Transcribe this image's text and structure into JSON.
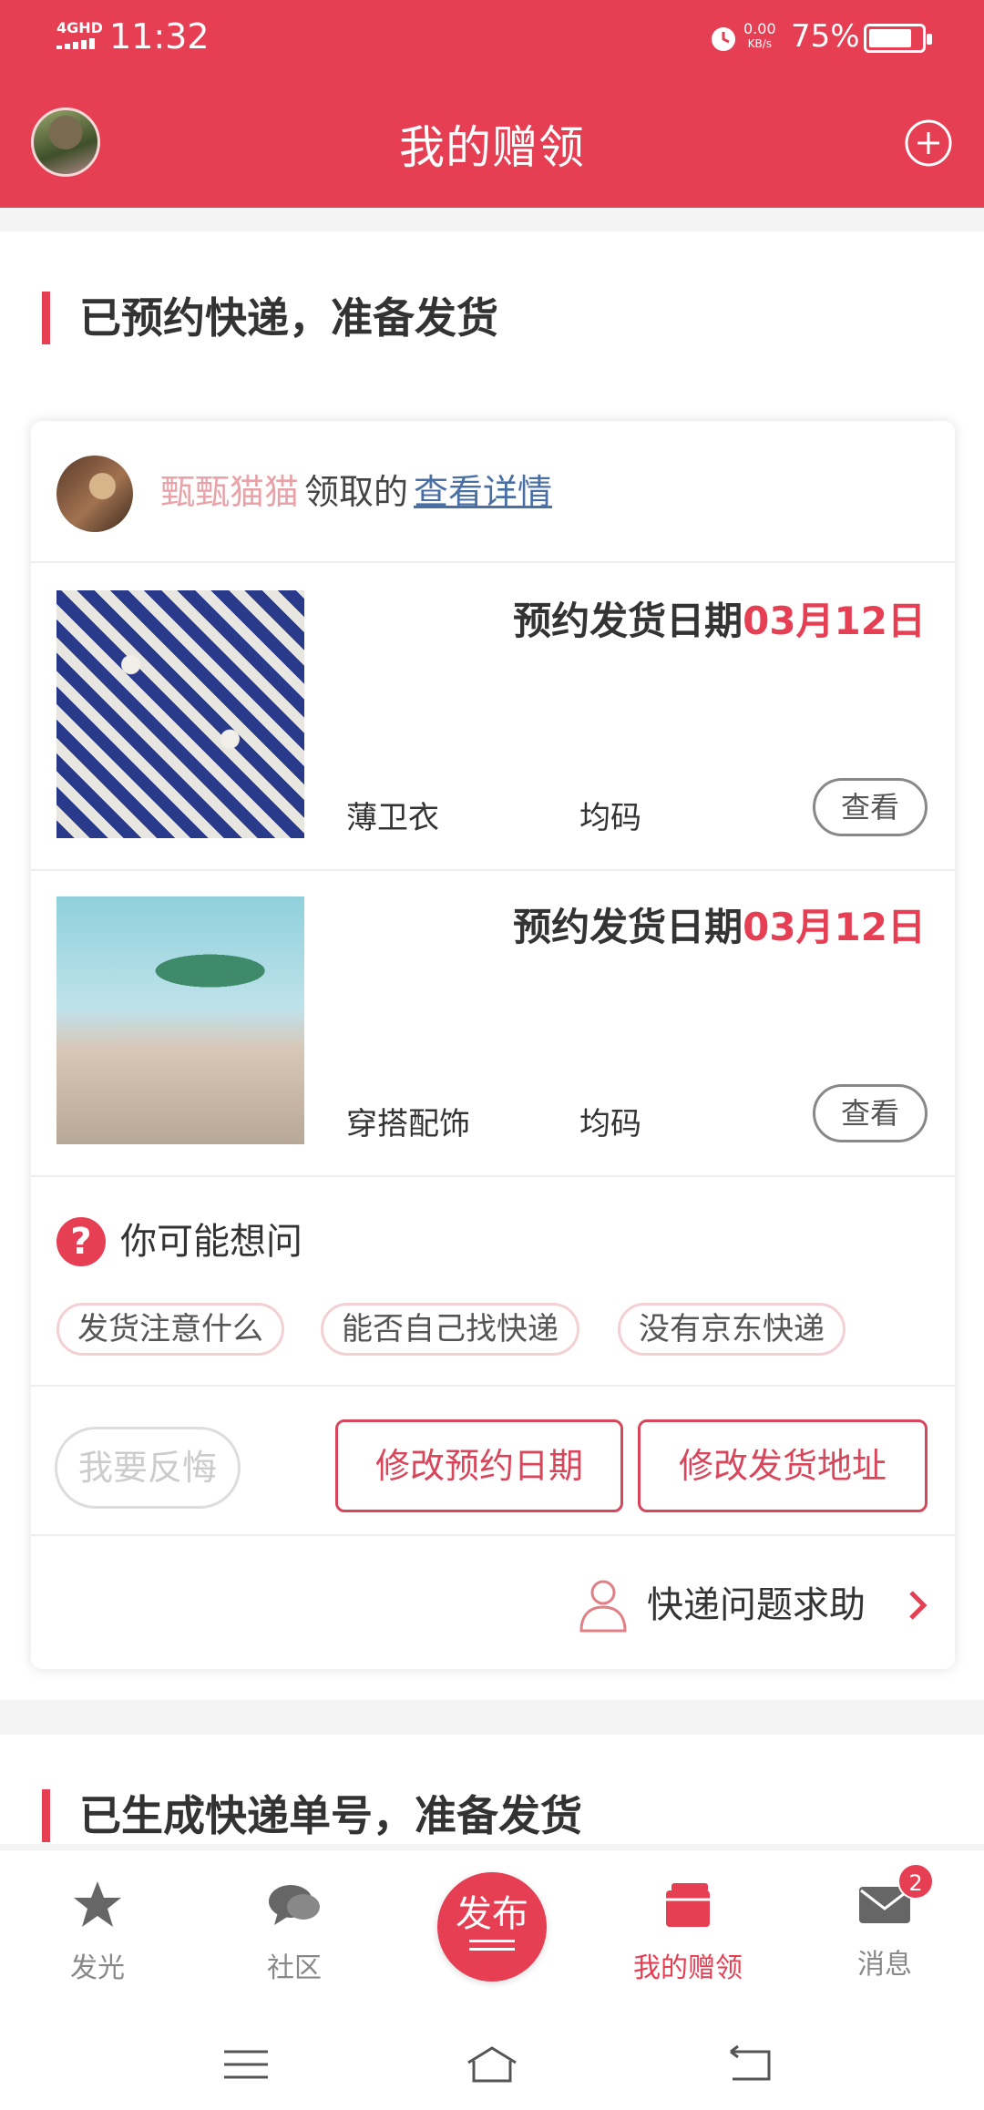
{
  "status_bar": {
    "network": "4GHD",
    "time": "11:32",
    "speed_value": "0.00",
    "speed_unit": "KB/s",
    "battery": "75%"
  },
  "header": {
    "title": "我的赠领",
    "add_icon": "plus-circle-icon"
  },
  "section1": {
    "title": "已预约快递，准备发货",
    "requester": {
      "name": "甄甄猫猫",
      "verb": "领取的",
      "link": "查看详情"
    },
    "items": [
      {
        "ship_label": "预约发货日期",
        "ship_date": "03月12日",
        "name": "薄卫衣",
        "size": "均码",
        "view": "查看"
      },
      {
        "ship_label": "预约发货日期",
        "ship_date": "03月12日",
        "name": "穿搭配饰",
        "size": "均码",
        "view": "查看"
      }
    ],
    "faq": {
      "icon": "question-icon",
      "title": "你可能想问",
      "chips": [
        "发货注意什么",
        "能否自己找快递",
        "没有京东快递"
      ]
    },
    "actions": {
      "regret": "我要反悔",
      "change_date": "修改预约日期",
      "change_address": "修改发货地址"
    },
    "help": {
      "text": "快递问题求助"
    }
  },
  "section2": {
    "title": "已生成快递单号，准备发货"
  },
  "bottom_nav": {
    "items": [
      {
        "label": "发光",
        "icon": "star-icon"
      },
      {
        "label": "社区",
        "icon": "chat-bubbles-icon"
      },
      {
        "label": "发布",
        "icon": "publish-icon"
      },
      {
        "label": "我的赠领",
        "icon": "gift-box-icon"
      },
      {
        "label": "消息",
        "icon": "mail-icon",
        "badge": "2"
      }
    ]
  },
  "colors": {
    "brand": "#e63e53",
    "link": "#4a6fa5"
  }
}
